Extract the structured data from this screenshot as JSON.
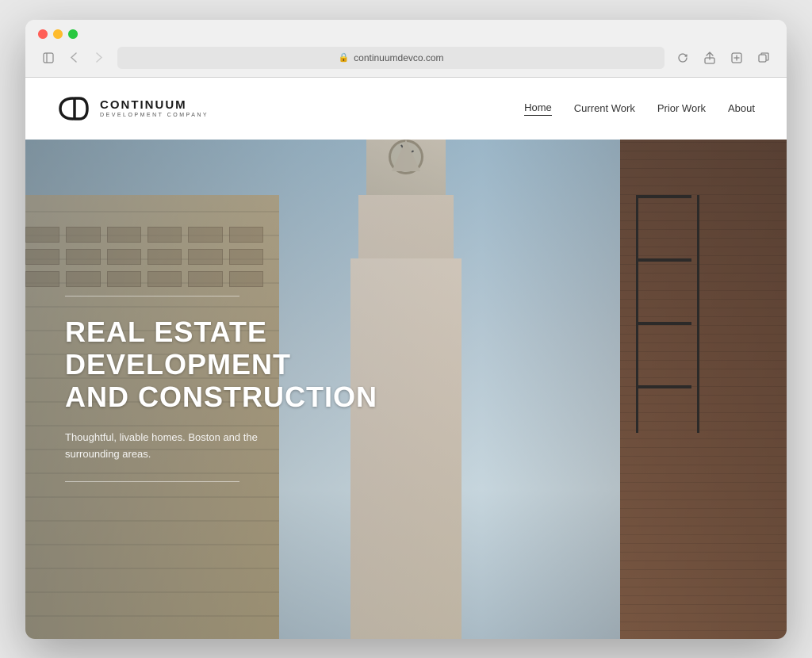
{
  "browser": {
    "url": "continuumdevco.com",
    "back_btn": "‹",
    "forward_btn": "›",
    "reload_btn": "↺",
    "sidebar_btn": "⊞",
    "share_btn": "⬆",
    "new_tab_btn": "+",
    "windows_btn": "⧉"
  },
  "site": {
    "logo_name": "CONTINUUM",
    "logo_sub": "DEVELOPMENT COMPANY",
    "nav": {
      "home": "Home",
      "current_work": "Current Work",
      "prior_work": "Prior Work",
      "about": "About"
    }
  },
  "hero": {
    "title_line1": "REAL ESTATE",
    "title_line2": "DEVELOPMENT",
    "title_line3": "AND CONSTRUCTION",
    "subtitle": "Thoughtful, livable homes. Boston and the surrounding areas."
  }
}
